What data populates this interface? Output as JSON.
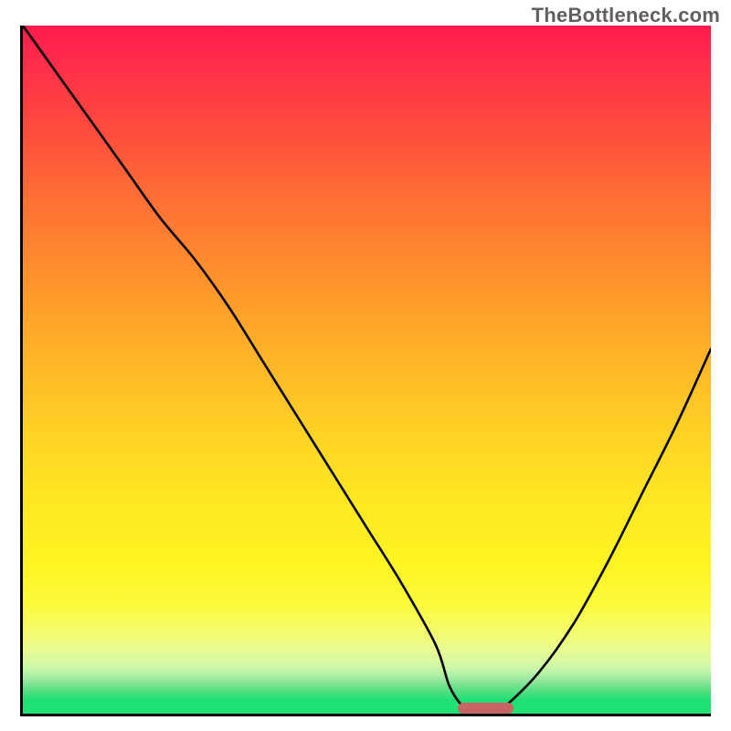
{
  "watermark": "TheBottleneck.com",
  "colors": {
    "axis": "#000000",
    "curve": "#000000",
    "marker": "#c86464",
    "watermark": "#606060"
  },
  "chart_data": {
    "type": "line",
    "title": "",
    "xlabel": "",
    "ylabel": "",
    "xlim": [
      0,
      100
    ],
    "ylim": [
      0,
      100
    ],
    "x": [
      0,
      5,
      10,
      15,
      20,
      25,
      30,
      35,
      40,
      45,
      50,
      55,
      60,
      62,
      64,
      66,
      68,
      70,
      75,
      80,
      85,
      90,
      95,
      100
    ],
    "values": [
      100,
      93,
      86,
      79,
      72,
      66,
      59,
      51,
      43,
      35,
      27,
      19,
      10,
      4,
      1,
      0,
      0,
      1,
      6,
      13,
      22,
      32,
      42,
      53
    ],
    "gradient_stops": [
      {
        "pos": 0,
        "color": "#ff1a4d"
      },
      {
        "pos": 0.3,
        "color": "#ff7a30"
      },
      {
        "pos": 0.6,
        "color": "#ffd424"
      },
      {
        "pos": 0.85,
        "color": "#fff322"
      },
      {
        "pos": 0.95,
        "color": "#9be9a0"
      },
      {
        "pos": 1.0,
        "color": "#1fe072"
      }
    ],
    "marker": {
      "x_start": 63,
      "x_end": 71,
      "y": 0
    },
    "description": "V-shaped bottleneck curve over red-yellow-green vertical gradient; minimum (optimal point) centered around x≈65–70 where curve touches the green band. Highlighted segment shown as a rounded pink bar at the bottom between roughly 63% and 71% of the x-range."
  }
}
